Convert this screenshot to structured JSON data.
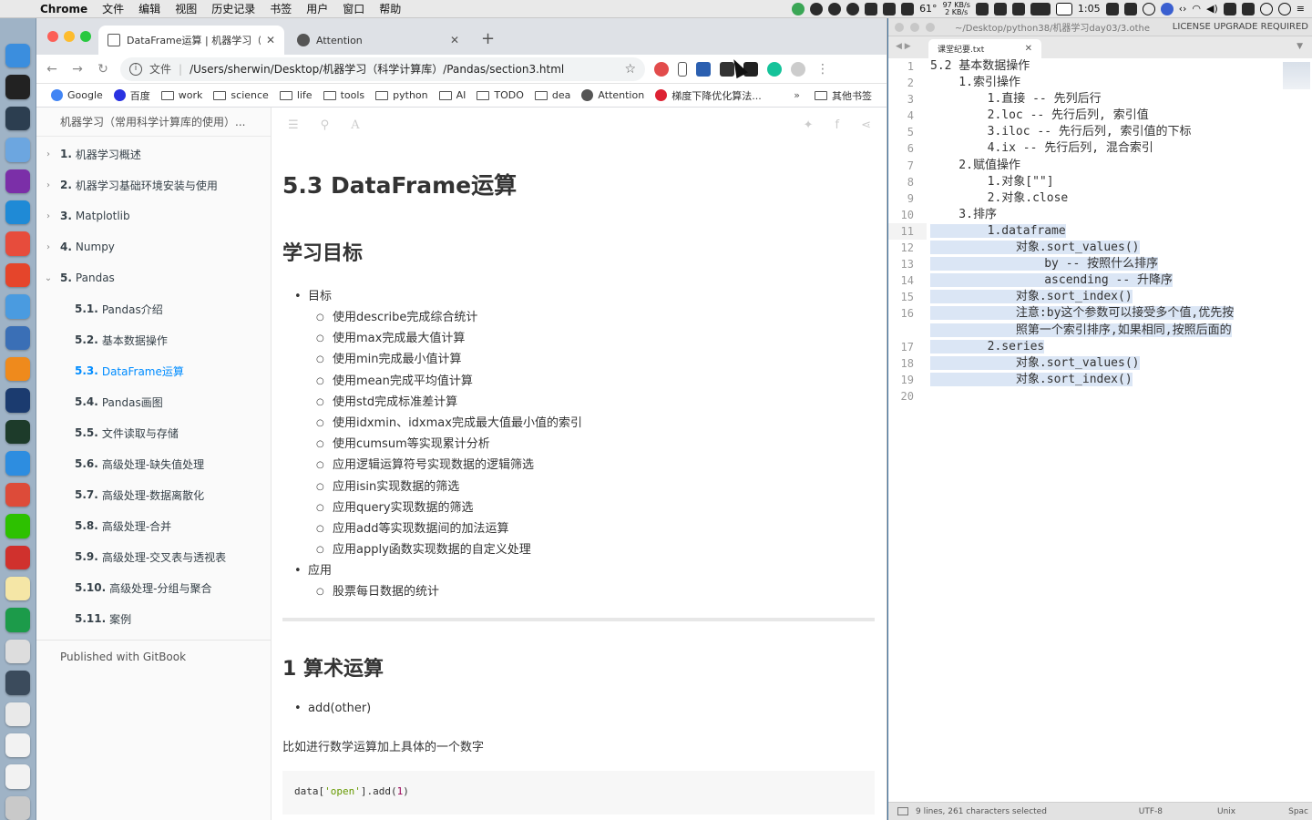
{
  "menubar": {
    "app": "Chrome",
    "items": [
      "文件",
      "编辑",
      "视图",
      "历史记录",
      "书签",
      "用户",
      "窗口",
      "帮助"
    ],
    "temp": "61°",
    "net_up": "97 KB/s",
    "net_down": "2 KB/s",
    "battery_time": "1:05"
  },
  "chrome": {
    "active_tab": "DataFrame运算 | 机器学习（常",
    "inactive_tab": "Attention",
    "url_scheme": "文件",
    "url": "/Users/sherwin/Desktop/机器学习（科学计算库）/Pandas/section3.html",
    "bookmarks": [
      {
        "label": "Google",
        "kind": "google"
      },
      {
        "label": "百度",
        "kind": "baidu"
      },
      {
        "label": "work",
        "kind": "folder"
      },
      {
        "label": "science",
        "kind": "folder"
      },
      {
        "label": "life",
        "kind": "folder"
      },
      {
        "label": "tools",
        "kind": "folder"
      },
      {
        "label": "python",
        "kind": "folder"
      },
      {
        "label": "AI",
        "kind": "folder"
      },
      {
        "label": "TODO",
        "kind": "folder"
      },
      {
        "label": "dea",
        "kind": "folder"
      },
      {
        "label": "Attention",
        "kind": "globe"
      },
      {
        "label": "梯度下降优化算法...",
        "kind": "red"
      }
    ],
    "bookmarks_more": "»",
    "other_bookmarks": "其他书签"
  },
  "summary": {
    "header": "机器学习（常用科学计算库的使用）...",
    "items": [
      {
        "num": "1.",
        "label": "机器学习概述",
        "level": 1,
        "chev": "›"
      },
      {
        "num": "2.",
        "label": "机器学习基础环境安装与使用",
        "level": 1,
        "chev": "›"
      },
      {
        "num": "3.",
        "label": "Matplotlib",
        "level": 1,
        "chev": "›"
      },
      {
        "num": "4.",
        "label": "Numpy",
        "level": 1,
        "chev": "›"
      },
      {
        "num": "5.",
        "label": "Pandas",
        "level": 1,
        "chev": "⌄"
      },
      {
        "num": "5.1.",
        "label": "Pandas介绍",
        "level": 2
      },
      {
        "num": "5.2.",
        "label": "基本数据操作",
        "level": 2
      },
      {
        "num": "5.3.",
        "label": "DataFrame运算",
        "level": 2,
        "active": true
      },
      {
        "num": "5.4.",
        "label": "Pandas画图",
        "level": 2
      },
      {
        "num": "5.5.",
        "label": "文件读取与存储",
        "level": 2
      },
      {
        "num": "5.6.",
        "label": "高级处理-缺失值处理",
        "level": 2
      },
      {
        "num": "5.7.",
        "label": "高级处理-数据离散化",
        "level": 2
      },
      {
        "num": "5.8.",
        "label": "高级处理-合并",
        "level": 2
      },
      {
        "num": "5.9.",
        "label": "高级处理-交叉表与透视表",
        "level": 2
      },
      {
        "num": "5.10.",
        "label": "高级处理-分组与聚合",
        "level": 2
      },
      {
        "num": "5.11.",
        "label": "案例",
        "level": 2
      }
    ],
    "published": "Published with GitBook"
  },
  "page": {
    "title": "5.3 DataFrame运算",
    "goals_heading": "学习目标",
    "goal_label": "目标",
    "goals": [
      "使用describe完成综合统计",
      "使用max完成最大值计算",
      "使用min完成最小值计算",
      "使用mean完成平均值计算",
      "使用std完成标准差计算",
      "使用idxmin、idxmax完成最大值最小值的索引",
      "使用cumsum等实现累计分析",
      "应用逻辑运算符号实现数据的逻辑筛选",
      "应用isin实现数据的筛选",
      "应用query实现数据的筛选",
      "应用add等实现数据间的加法运算",
      "应用apply函数实现数据的自定义处理"
    ],
    "app_label": "应用",
    "apps": [
      "股票每日数据的统计"
    ],
    "section1": "1 算术运算",
    "section1_item": "add(other)",
    "section1_para": "比如进行数学运算加上具体的一个数字",
    "code_pre": "data[",
    "code_str": "'open'",
    "code_mid": "].add(",
    "code_num": "1",
    "code_post": ")"
  },
  "sublime": {
    "path": "~/Desktop/python38/机器学习day03/3.othe",
    "license": "LICENSE UPGRADE REQUIRED",
    "tab": "课堂纪要.txt",
    "lines": [
      "5.2 基本数据操作",
      "    1.索引操作",
      "        1.直接 -- 先列后行",
      "        2.loc -- 先行后列, 索引值",
      "        3.iloc -- 先行后列, 索引值的下标",
      "        4.ix -- 先行后列, 混合索引",
      "    2.赋值操作",
      "        1.对象[\"\"]",
      "        2.对象.close",
      "    3.排序",
      "        1.dataframe",
      "            对象.sort_values()",
      "                by -- 按照什么排序",
      "                ascending -- 升降序",
      "            对象.sort_index()",
      "            注意:by这个参数可以接受多个值,优先按",
      "            照第一个索引排序,如果相同,按照后面的",
      "        2.series",
      "            对象.sort_values()",
      "            对象.sort_index()",
      ""
    ],
    "line_numbers": [
      "1",
      "2",
      "3",
      "4",
      "5",
      "6",
      "7",
      "8",
      "9",
      "10",
      "11",
      "12",
      "13",
      "14",
      "15",
      "16",
      "",
      "17",
      "18",
      "19",
      "20"
    ],
    "status": "9 lines, 261 characters selected",
    "encoding": "UTF-8",
    "line_endings": "Unix",
    "spaces": "Spac"
  },
  "dock_icons": [
    {
      "name": "finder-icon",
      "color": "#3b8ede"
    },
    {
      "name": "terminal-icon",
      "color": "#222222"
    },
    {
      "name": "macos-icon",
      "color": "#2c3e50"
    },
    {
      "name": "preview-icon",
      "color": "#6ca6e0"
    },
    {
      "name": "onenote-icon",
      "color": "#7b2fa8"
    },
    {
      "name": "maps-icon",
      "color": "#1f8ad6"
    },
    {
      "name": "sogou-icon",
      "color": "#e74c3c"
    },
    {
      "name": "gitmind-icon",
      "color": "#e5452b"
    },
    {
      "name": "pencil-icon",
      "color": "#4a9be0"
    },
    {
      "name": "launchpad-icon",
      "color": "#3a6fb6"
    },
    {
      "name": "sublime-icon",
      "color": "#ef8a1c"
    },
    {
      "name": "quicktime-icon",
      "color": "#1b3b6f"
    },
    {
      "name": "activity-icon",
      "color": "#1d3b2a"
    },
    {
      "name": "safari-icon",
      "color": "#2d8de0"
    },
    {
      "name": "chrome-icon",
      "color": "#dd4b39"
    },
    {
      "name": "wechat-icon",
      "color": "#2dc100"
    },
    {
      "name": "netease-music-icon",
      "color": "#d0312d"
    },
    {
      "name": "notes-icon",
      "color": "#f5e6a6"
    },
    {
      "name": "pycharm-icon",
      "color": "#1c9b4a"
    },
    {
      "name": "document-icon",
      "color": "#dddddd"
    },
    {
      "name": "screen-icon",
      "color": "#3b4b5c"
    },
    {
      "name": "folder-doc-icon",
      "color": "#e9e9e9"
    },
    {
      "name": "file-icon",
      "color": "#f2f2f2"
    },
    {
      "name": "file2-icon",
      "color": "#f2f2f2"
    },
    {
      "name": "trash-icon",
      "color": "#c9c9c9"
    }
  ],
  "colors": {
    "active_link": "#008cff",
    "selection": "#dbe6f5"
  }
}
